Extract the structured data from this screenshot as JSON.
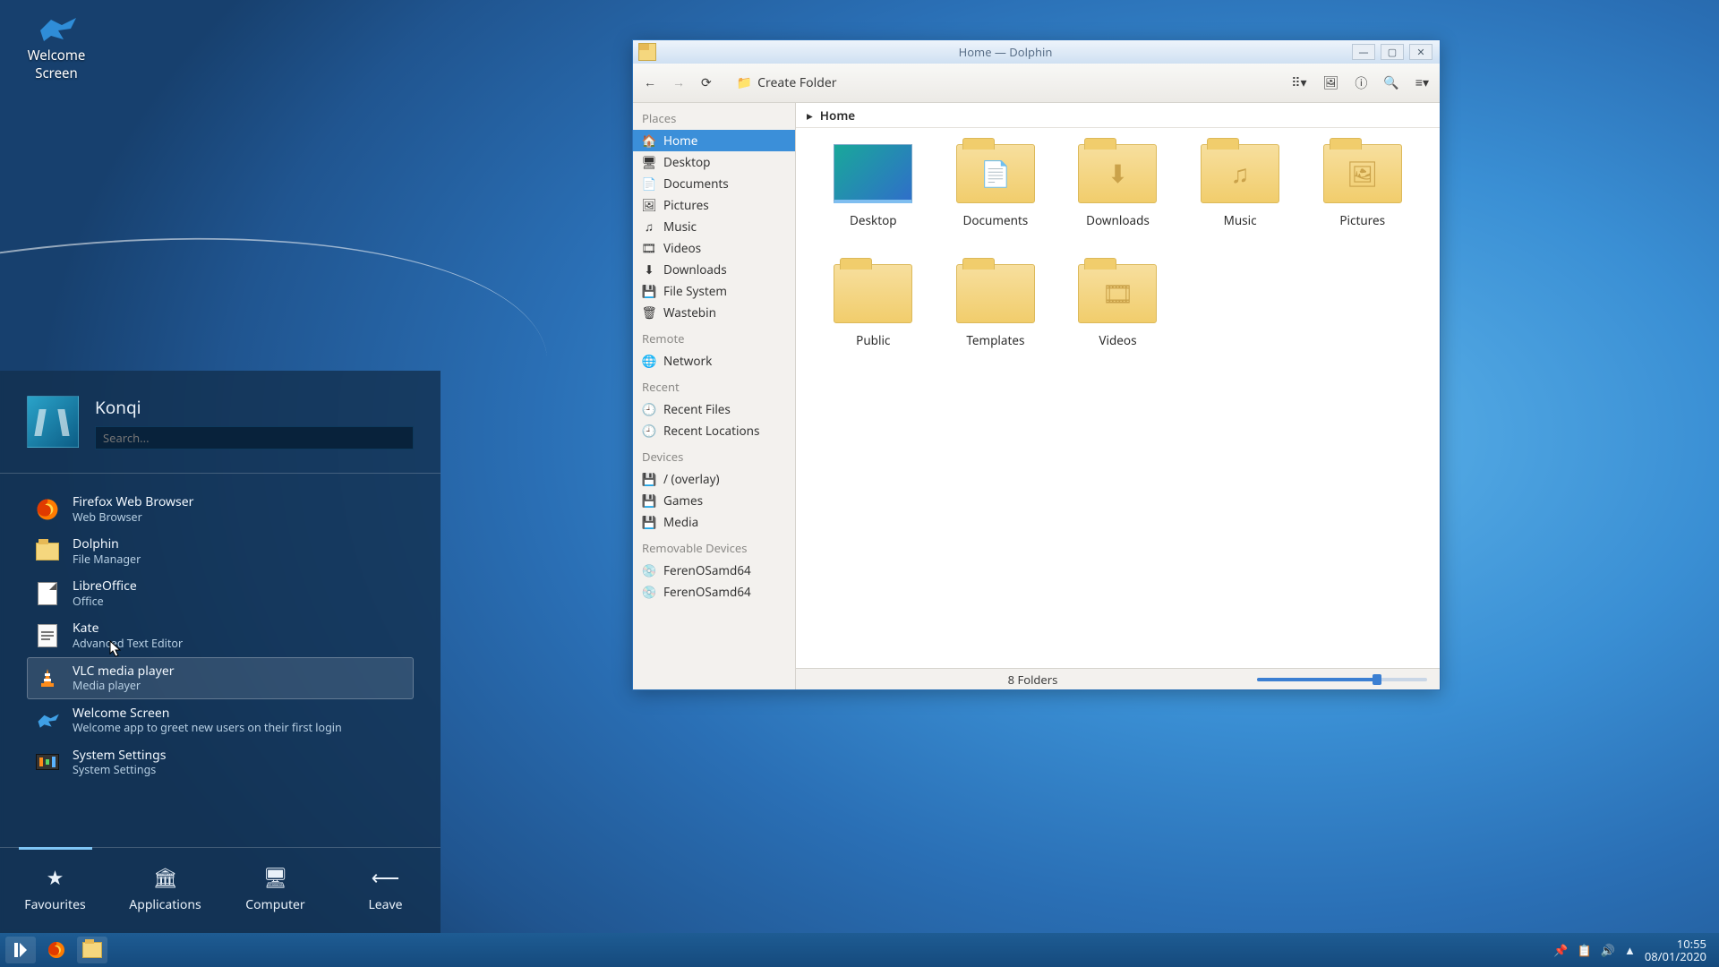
{
  "desktop": {
    "welcome_icon_label": "Welcome\nScreen"
  },
  "startmenu": {
    "user": "Konqi",
    "search_placeholder": "Search...",
    "items": [
      {
        "title": "Firefox Web Browser",
        "desc": "Web Browser",
        "icon": "firefox"
      },
      {
        "title": "Dolphin",
        "desc": "File Manager",
        "icon": "folder"
      },
      {
        "title": "LibreOffice",
        "desc": "Office",
        "icon": "libreoffice"
      },
      {
        "title": "Kate",
        "desc": "Advanced Text Editor",
        "icon": "kate"
      },
      {
        "title": "VLC media player",
        "desc": "Media player",
        "icon": "vlc",
        "hover": true
      },
      {
        "title": "Welcome Screen",
        "desc": "Welcome app to greet new users on their first login",
        "icon": "bird"
      },
      {
        "title": "System Settings",
        "desc": "System Settings",
        "icon": "settings"
      }
    ],
    "tabs": [
      {
        "label": "Favourites",
        "icon": "star",
        "active": true
      },
      {
        "label": "Applications",
        "icon": "apps"
      },
      {
        "label": "Computer",
        "icon": "monitor"
      },
      {
        "label": "Leave",
        "icon": "leave"
      }
    ]
  },
  "dolphin": {
    "title": "Home — Dolphin",
    "toolbar": {
      "create_folder": "Create Folder"
    },
    "breadcrumb": "Home",
    "sidebar": {
      "places_header": "Places",
      "places": [
        "Home",
        "Desktop",
        "Documents",
        "Pictures",
        "Music",
        "Videos",
        "Downloads",
        "File System",
        "Wastebin"
      ],
      "remote_header": "Remote",
      "remote": [
        "Network"
      ],
      "recent_header": "Recent",
      "recent": [
        "Recent Files",
        "Recent Locations"
      ],
      "devices_header": "Devices",
      "devices": [
        "/ (overlay)",
        "Games",
        "Media"
      ],
      "removable_header": "Removable Devices",
      "removable": [
        "FerenOSamd64",
        "FerenOSamd64"
      ]
    },
    "folders": [
      {
        "name": "Desktop",
        "type": "desktop"
      },
      {
        "name": "Documents",
        "glyph": "📄"
      },
      {
        "name": "Downloads",
        "glyph": "⬇"
      },
      {
        "name": "Music",
        "glyph": "♫"
      },
      {
        "name": "Pictures",
        "glyph": "🖼"
      },
      {
        "name": "Public",
        "glyph": ""
      },
      {
        "name": "Templates",
        "glyph": ""
      },
      {
        "name": "Videos",
        "glyph": "🎞"
      }
    ],
    "status": "8 Folders"
  },
  "taskbar": {
    "time": "10:55",
    "date": "08/01/2020"
  }
}
